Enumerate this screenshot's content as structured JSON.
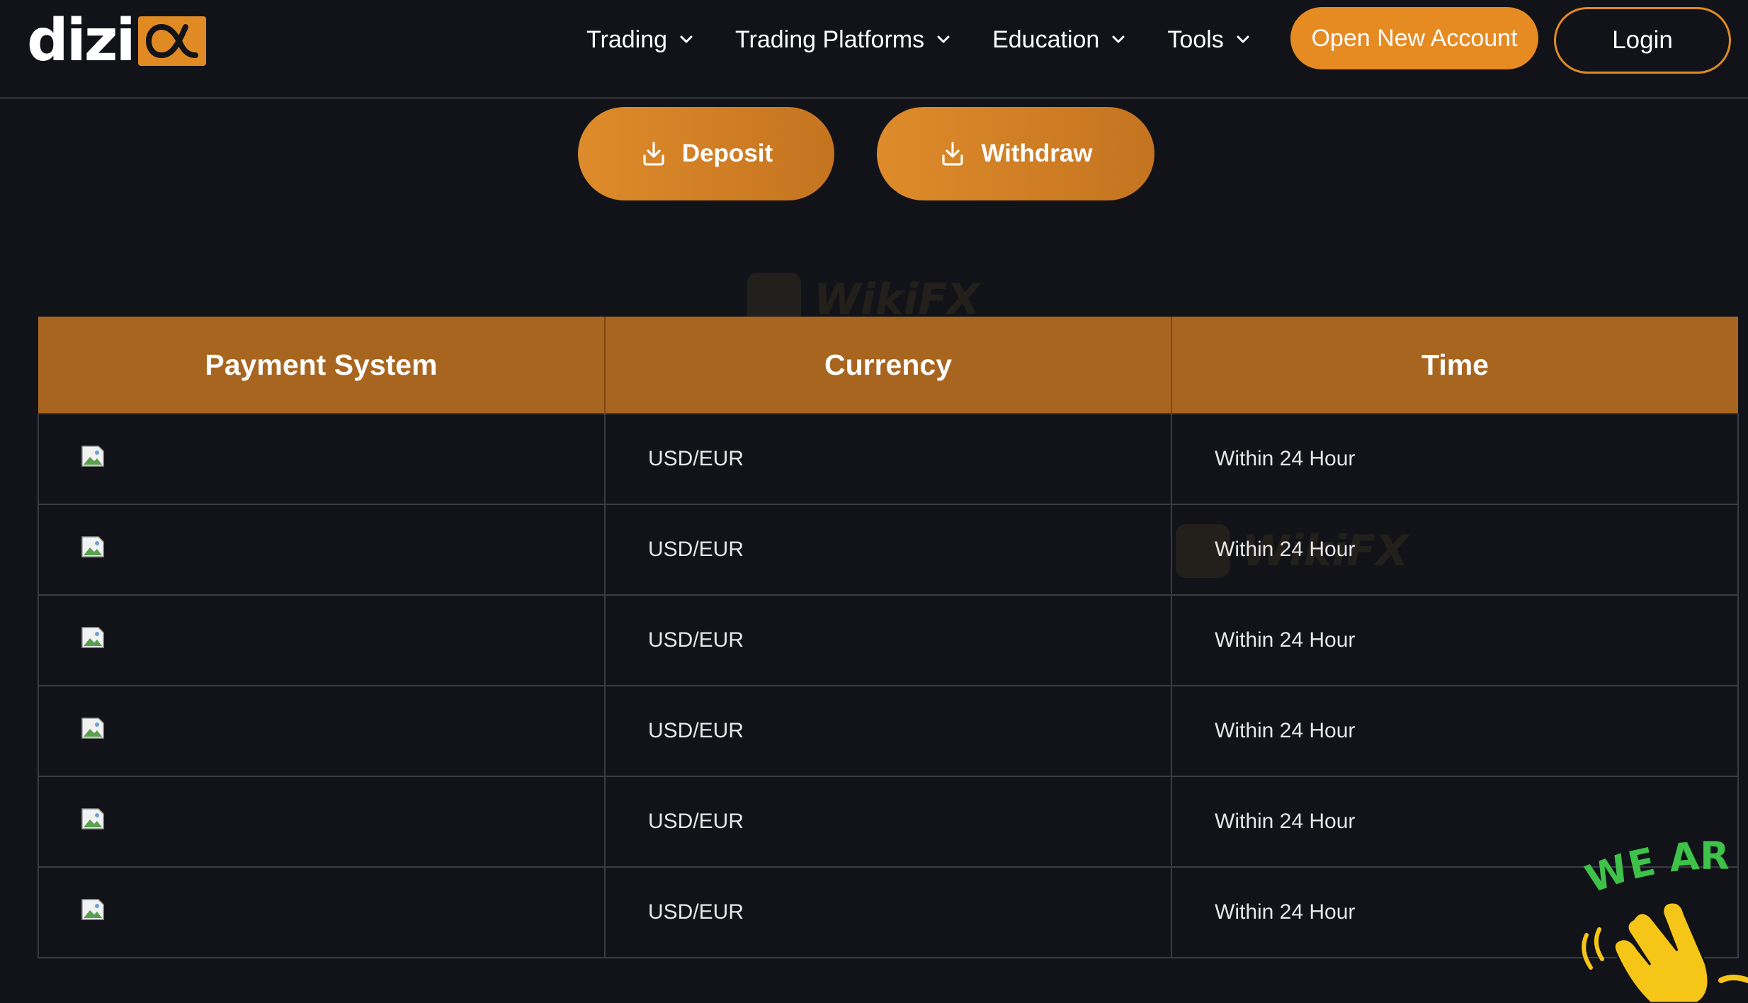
{
  "brand": {
    "logo_text": "dizi",
    "logo_mark": "α"
  },
  "nav": {
    "items": [
      {
        "label": "Trading"
      },
      {
        "label": "Trading Platforms"
      },
      {
        "label": "Education"
      },
      {
        "label": "Tools"
      }
    ],
    "open_account_label": "Open New Account",
    "login_label": "Login"
  },
  "actions": {
    "deposit_label": "Deposit",
    "withdraw_label": "Withdraw"
  },
  "table": {
    "headers": [
      "Payment System",
      "Currency",
      "Time"
    ],
    "rows": [
      {
        "currency": "USD/EUR",
        "time": "Within 24 Hour"
      },
      {
        "currency": "USD/EUR",
        "time": "Within 24 Hour"
      },
      {
        "currency": "USD/EUR",
        "time": "Within 24 Hour"
      },
      {
        "currency": "USD/EUR",
        "time": "Within 24 Hour"
      },
      {
        "currency": "USD/EUR",
        "time": "Within 24 Hour"
      },
      {
        "currency": "USD/EUR",
        "time": "Within 24 Hour"
      }
    ]
  },
  "sticker": {
    "text": "WE ARE"
  },
  "watermark": {
    "text": "WikiFX"
  },
  "colors": {
    "accent": "#e08a24",
    "background": "#111318",
    "table_header": "#a8651f",
    "sticker_text": "#3ec24a"
  }
}
